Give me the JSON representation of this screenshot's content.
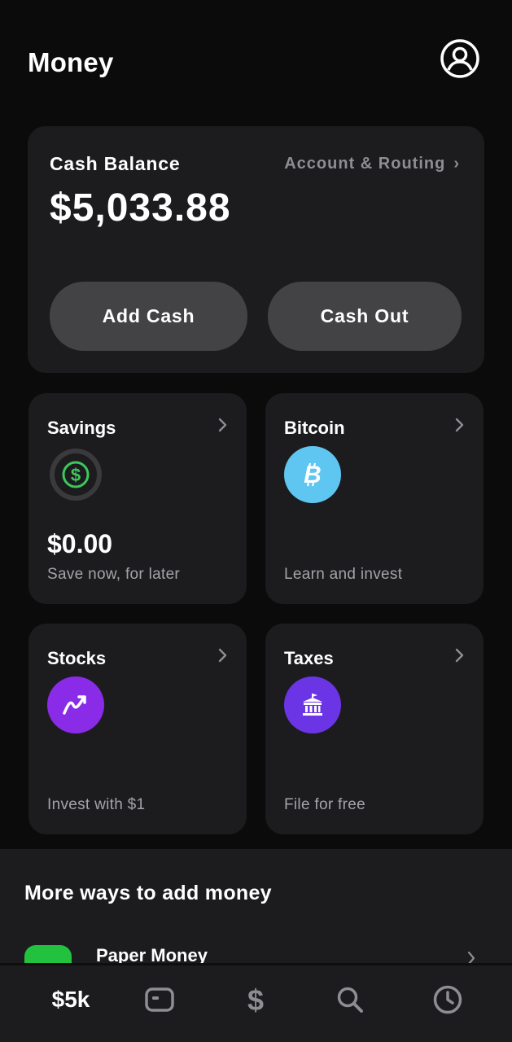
{
  "header": {
    "title": "Money"
  },
  "balance": {
    "label": "Cash Balance",
    "routing_link": "Account & Routing",
    "amount": "$5,033.88",
    "add_cash": "Add Cash",
    "cash_out": "Cash Out"
  },
  "tiles": [
    {
      "title": "Savings",
      "amount": "$0.00",
      "subtitle": "Save now, for later",
      "icon": "savings-dollar-icon",
      "color": "#3cc85a"
    },
    {
      "title": "Bitcoin",
      "subtitle": "Learn and invest",
      "icon": "bitcoin-icon",
      "color": "#5ec6f0"
    },
    {
      "title": "Stocks",
      "subtitle": "Invest with $1",
      "icon": "stocks-trend-icon",
      "color": "#8a2be8"
    },
    {
      "title": "Taxes",
      "subtitle": "File for free",
      "icon": "taxes-building-icon",
      "color": "#6b35e6"
    }
  ],
  "more_ways": {
    "title": "More ways to add money",
    "items": [
      {
        "label": "Paper Money",
        "color": "#22c23f"
      }
    ]
  },
  "tabbar": {
    "balance_label": "$5k",
    "items": [
      "card-icon",
      "dollar-icon",
      "search-icon",
      "clock-icon"
    ]
  }
}
